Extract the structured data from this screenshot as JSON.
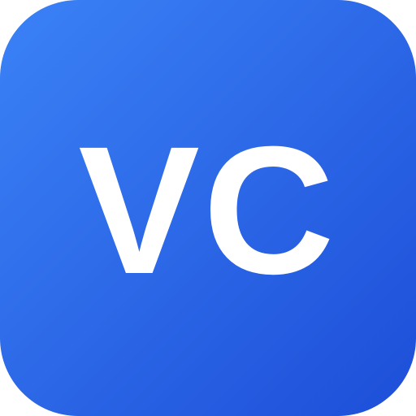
{
  "icon": {
    "monogram": "VC",
    "background_color_start": "#3b82f6",
    "background_color_end": "#1d4ed8",
    "text_color": "#ffffff"
  }
}
